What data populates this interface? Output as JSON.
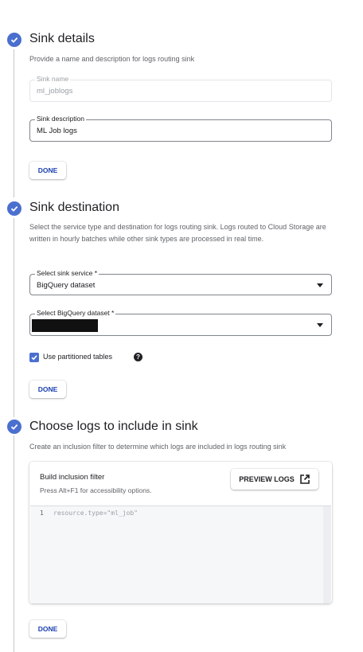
{
  "sections": [
    {
      "title": "Sink details",
      "description": "Provide a name and description for logs routing sink",
      "sink_name": {
        "label": "Sink name",
        "value": "ml_joblogs"
      },
      "sink_description": {
        "label": "Sink description",
        "value": "ML Job logs"
      },
      "done_label": "DONE"
    },
    {
      "title": "Sink destination",
      "description": "Select the service type and destination for logs routing sink. Logs routed to Cloud Storage are written in hourly batches while other sink types are processed in real time.",
      "sink_service": {
        "label": "Select sink service *",
        "value": "BigQuery dataset"
      },
      "dataset": {
        "label": "Select BigQuery dataset *",
        "value": ""
      },
      "partition_label": "Use partitioned tables",
      "partition_checked": true,
      "done_label": "DONE"
    },
    {
      "title": "Choose logs to include in sink",
      "description": "Create an inclusion filter to determine which logs are included in logs routing sink",
      "filter_title": "Build inclusion filter",
      "filter_hint": "Press Alt+F1 for accessibility options.",
      "preview_label": "PREVIEW LOGS",
      "editor_line_number": "1",
      "editor_code": "resource.type=\"ml_job\"",
      "done_label": "DONE"
    }
  ],
  "icons": {
    "step_complete": "check-circle-icon",
    "help": "help-icon",
    "open_new": "open-in-new-icon",
    "dropdown": "chevron-down-icon"
  },
  "colors": {
    "accent": "#4a6fcf",
    "button_text": "#1a3fae"
  }
}
